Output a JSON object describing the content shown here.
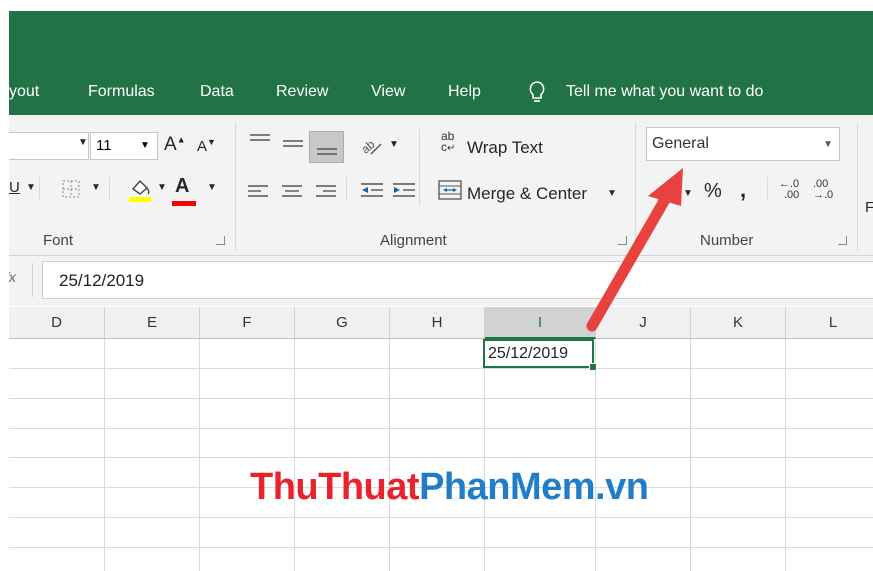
{
  "menu": {
    "tabs": [
      "yout",
      "Formulas",
      "Data",
      "Review",
      "View",
      "Help"
    ],
    "tell_me": "Tell me what you want to do"
  },
  "ribbon": {
    "font": {
      "size_value": "11",
      "grow_label": "A",
      "shrink_label": "A",
      "underline_label": "U",
      "font_color_label": "A",
      "group_label": "Font"
    },
    "alignment": {
      "wrap_text_label": "Wrap Text",
      "wrap_icon_top": "ab",
      "wrap_icon_bottom": "c",
      "merge_center_label": "Merge & Center",
      "group_label": "Alignment"
    },
    "number": {
      "format_value": "General",
      "percent_label": "%",
      "comma_label": ",",
      "increase_decimal_top": "←.0",
      "increase_decimal_bottom": ".00",
      "decrease_decimal_top": ".00",
      "decrease_decimal_bottom": "→.0",
      "group_label": "Number",
      "partial_label": "F"
    },
    "colors": {
      "highlight": "#ffff00",
      "font_color": "#ff0000"
    }
  },
  "formula_bar": {
    "fx_label": "fx",
    "content": "25/12/2019"
  },
  "sheet": {
    "columns": [
      "D",
      "E",
      "F",
      "G",
      "H",
      "I",
      "J",
      "K",
      "L"
    ],
    "selected_column": "I",
    "selected_cell_value": "25/12/2019"
  },
  "watermark": {
    "part1": "ThuThuat",
    "part2": "PhanMem",
    "part3": ".vn"
  },
  "accent_color": "#217346",
  "arrow_color": "#e8423f"
}
